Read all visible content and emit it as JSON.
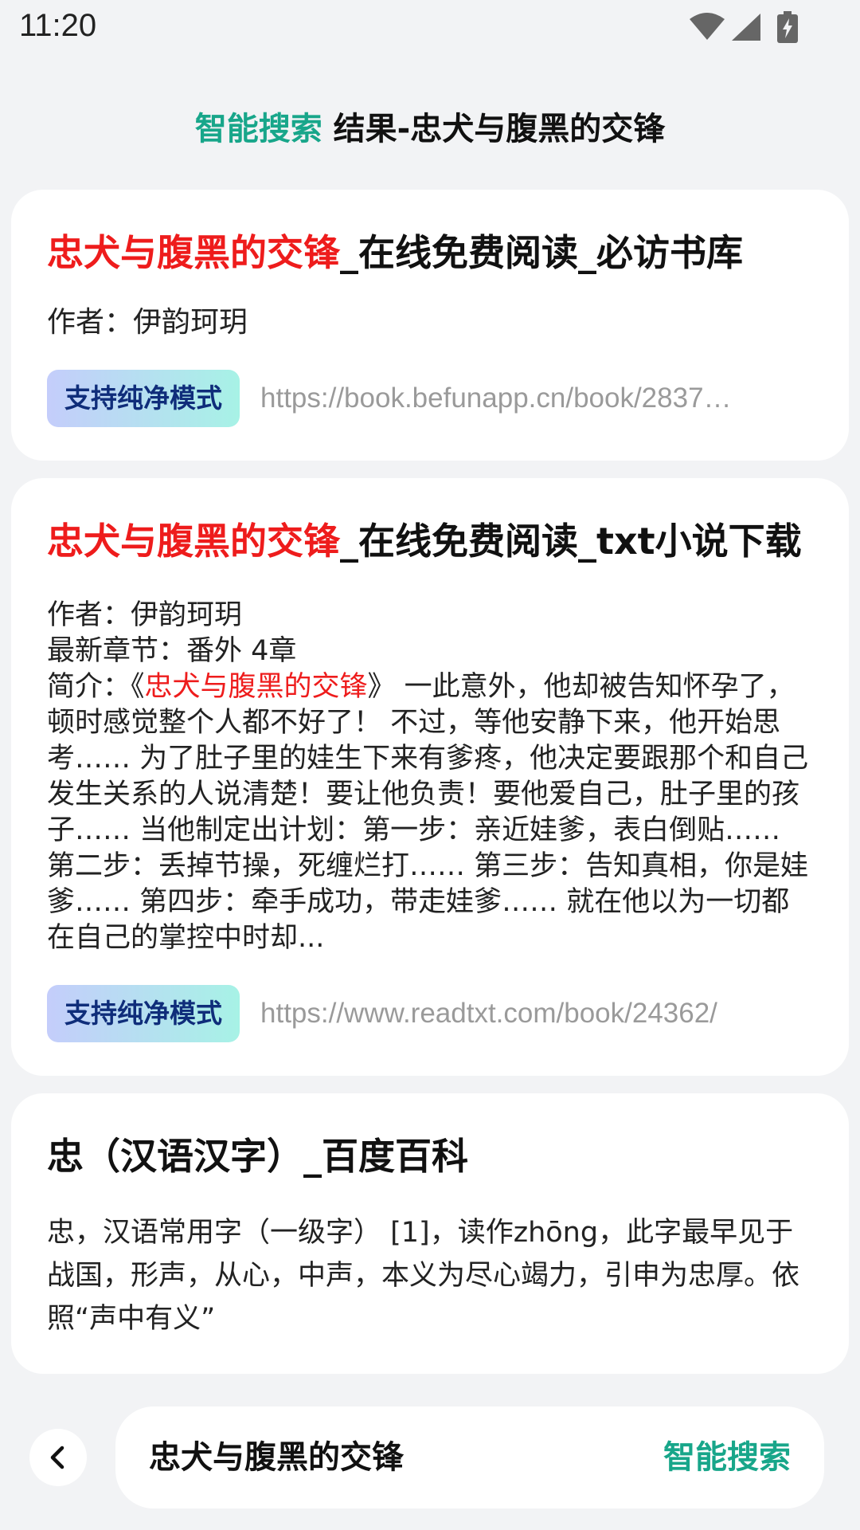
{
  "status_bar": {
    "time": "11:20",
    "icons": [
      "wifi-icon",
      "cellular-signal-icon",
      "battery-charging-icon"
    ]
  },
  "header": {
    "title_accent": "智能搜索",
    "title_rest": " 结果-忠犬与腹黑的交锋"
  },
  "results": [
    {
      "title_highlight": "忠犬与腹黑的交锋",
      "title_rest": "_在线免费阅读_必访书库",
      "author": "作者：伊韵珂玥",
      "badge": "支持纯净模式",
      "url": "https://book.befunapp.cn/book/2837…"
    },
    {
      "title_highlight": "忠犬与腹黑的交锋",
      "title_rest": "_在线免费阅读_txt小说下载",
      "author": "作者：伊韵珂玥",
      "latest": "最新章节：番外 4章",
      "intro_prefix": "简介：《",
      "intro_highlight": "忠犬与腹黑的交锋",
      "intro_rest": "》 一此意外，他却被告知怀孕了，顿时感觉整个人都不好了！ 不过，等他安静下来，他开始思考…… 为了肚子里的娃生下来有爹疼，他决定要跟那个和自己发生关系的人说清楚！要让他负责！要他爱自己，肚子里的孩子…… 当他制定出计划：第一步：亲近娃爹，表白倒贴…… 第二步：丢掉节操，死缠烂打…… 第三步：告知真相，你是娃爹…… 第四步：牵手成功，带走娃爹…… 就在他以为一切都在自己的掌控中时却...",
      "badge": "支持纯净模式",
      "url": "https://www.readtxt.com/book/24362/"
    },
    {
      "title": "忠（汉语汉字）_百度百科",
      "snippet": "忠，汉语常用字（一级字） [1]，读作zhōng，此字最早见于战国，形声，从心，中声，本义为尽心竭力，引申为忠厚。依照“声中有义”"
    }
  ],
  "bottom_bar": {
    "back_icon": "chevron-left-icon",
    "query": "忠犬与腹黑的交锋",
    "action_label": "智能搜索"
  },
  "colors": {
    "accent": "#18a68a",
    "highlight": "#ee1c1c",
    "background": "#f2f3f5",
    "url": "#9a9a9a",
    "badge_text": "#0f2d7a"
  }
}
